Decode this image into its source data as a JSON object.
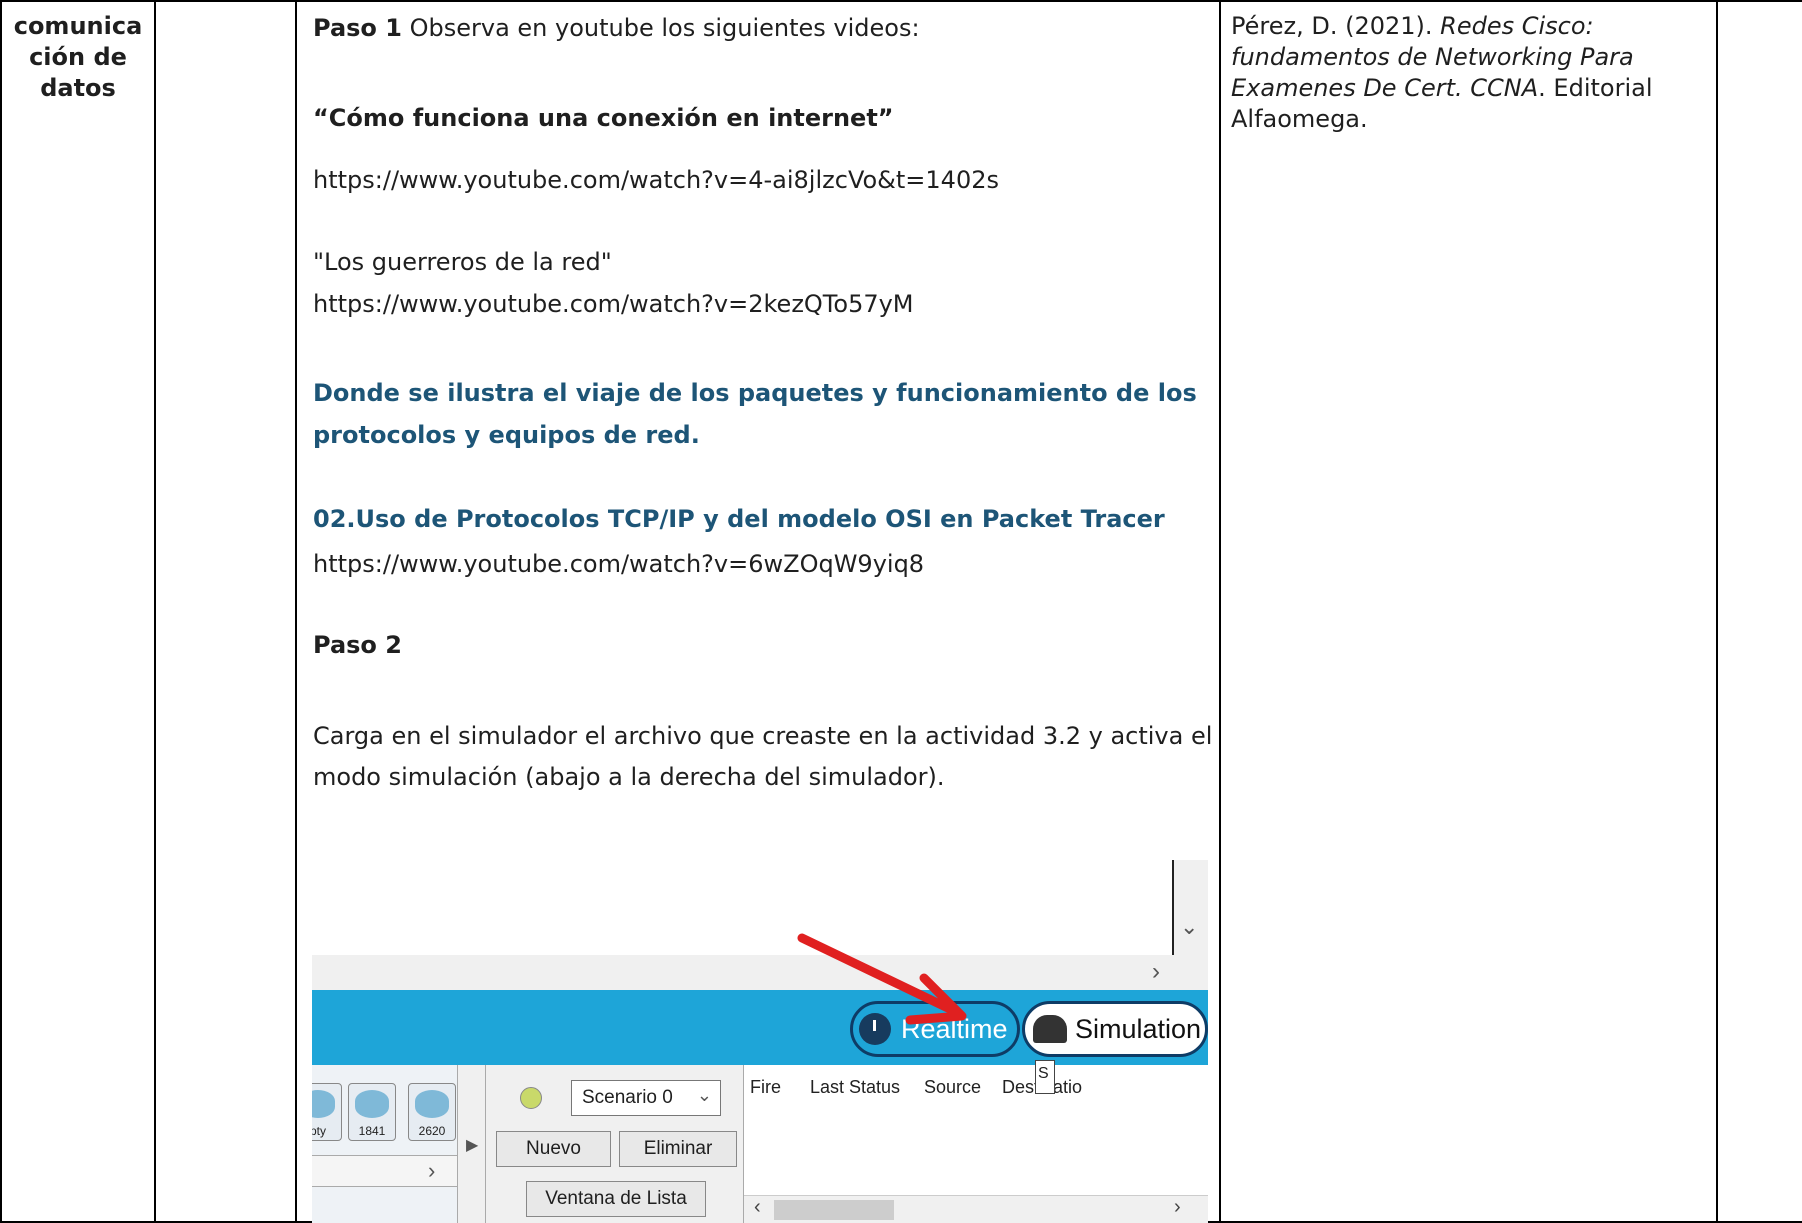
{
  "topic": {
    "line1": "comunica",
    "line2": "ción de",
    "line3": "datos"
  },
  "main": {
    "paso1_label": "Paso 1",
    "paso1_text": " Observa en youtube los siguientes videos:",
    "video1_title": "“Cómo funciona una conexión en internet”",
    "video1_url": "https://www.youtube.com/watch?v=4-ai8jlzcVo&t=1402s",
    "video2_title": "\"Los guerreros de la red\"",
    "video2_url": "https://www.youtube.com/watch?v=2kezQTo57yM",
    "highlight_line1": "Donde se ilustra el viaje de los paquetes y funcionamiento de los",
    "highlight_line2": "protocolos y equipos de red.",
    "video3_title": "02.Uso de Protocolos TCP/IP y del modelo OSI en Packet Tracer",
    "video3_url": "https://www.youtube.com/watch?v=6wZOqW9yiq8",
    "paso2_label": "Paso 2",
    "paso2_line1": "Carga en el simulador el archivo que creaste en la actividad 3.2 y activa el",
    "paso2_line2": "modo simulación (abajo a la derecha del simulador)."
  },
  "reference": {
    "author": "Pérez, D. (2021). ",
    "title": "Redes Cisco: fundamentos de Networking Para Examenes De Cert. CCNA",
    "rest": ". Editorial Alfaomega."
  },
  "screenshot": {
    "realtime_label": "Realtime",
    "simulation_label": "Simulation",
    "devices": [
      "pty",
      "1841",
      "2620"
    ],
    "scenario_select": "Scenario 0",
    "new_button": "Nuevo",
    "delete_button": "Eliminar",
    "pdu_window_button": "Ventana de Lista PDU",
    "columns": [
      "Fire",
      "Last Status",
      "Source",
      "Destinatio"
    ],
    "tooltip": "S",
    "arrow_color": "#e02020",
    "bar_color": "#1ea5d8"
  }
}
